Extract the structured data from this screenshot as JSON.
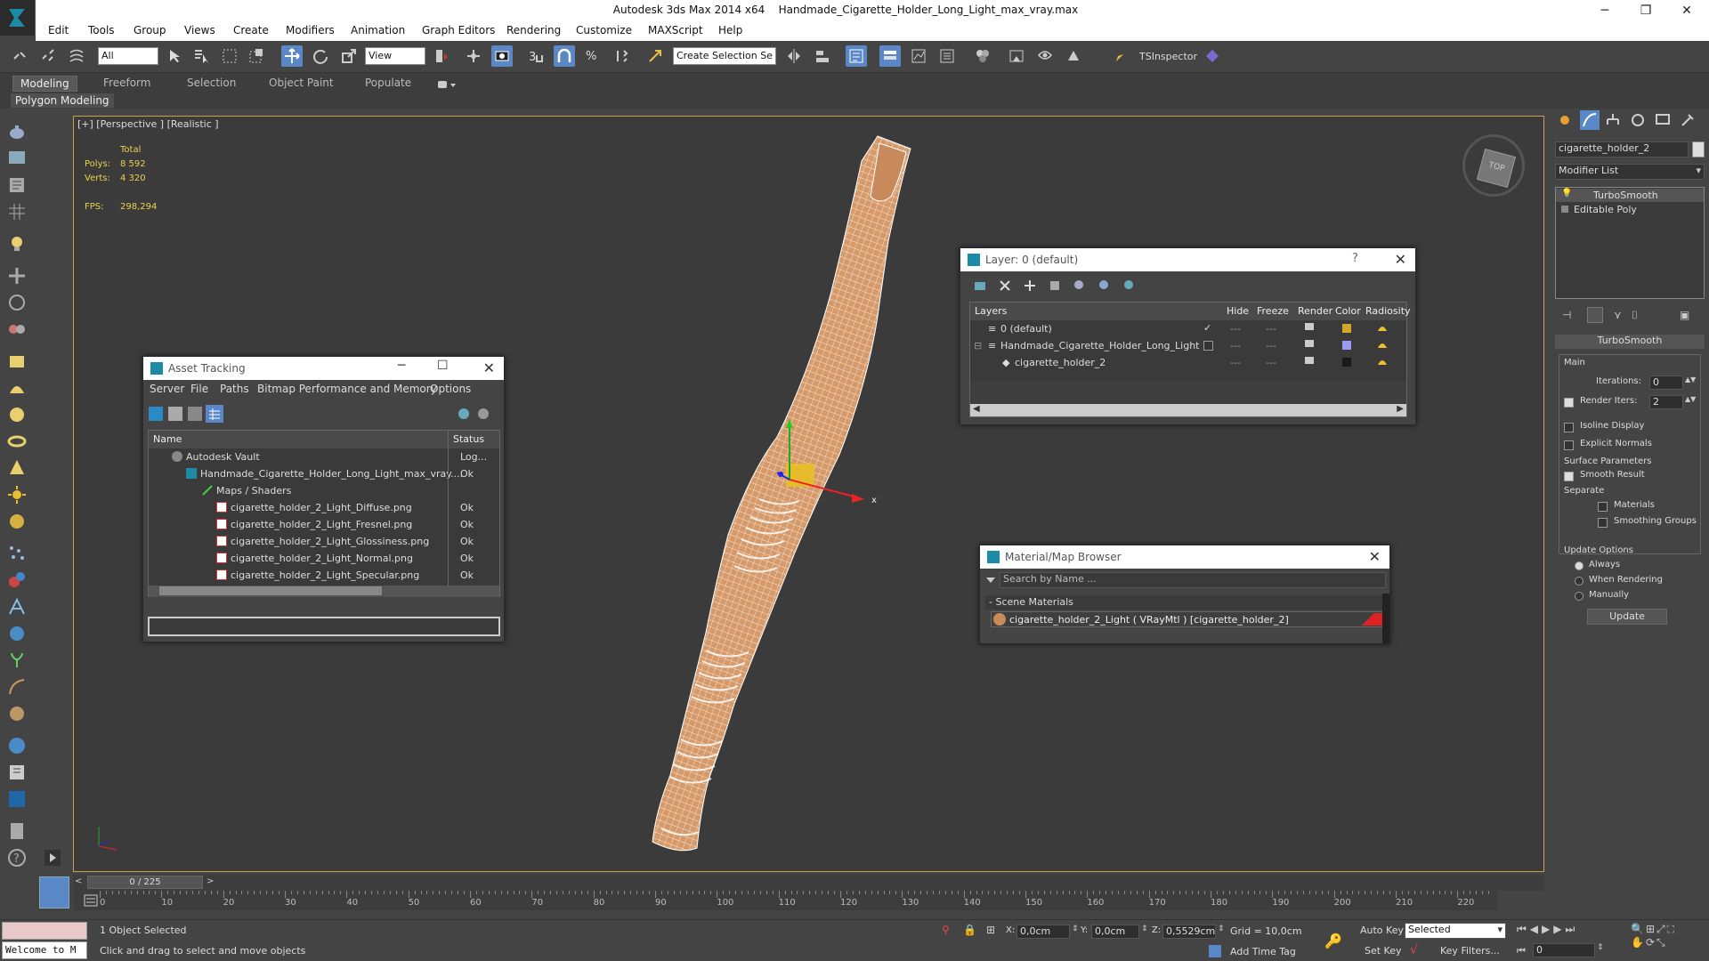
{
  "app": {
    "name": "Autodesk 3ds Max  2014 x64",
    "file": "Handmade_Cigarette_Holder_Long_Light_max_vray.max"
  },
  "menu": [
    "Edit",
    "Tools",
    "Group",
    "Views",
    "Create",
    "Modifiers",
    "Animation",
    "Graph Editors",
    "Rendering",
    "Customize",
    "MAXScript",
    "Help"
  ],
  "toolbar": {
    "filter": "All",
    "view": "View",
    "selection_set": "Create Selection Se",
    "tsinspector": "TSInspector"
  },
  "ribbon": {
    "tabs": [
      "Modeling",
      "Freeform",
      "Selection",
      "Object Paint",
      "Populate"
    ],
    "sub": "Polygon Modeling"
  },
  "viewport": {
    "label": "[+] [Perspective ] [Realistic ]",
    "stats": {
      "total_label": "Total",
      "polys_label": "Polys:",
      "polys": "8 592",
      "verts_label": "Verts:",
      "verts": "4 320",
      "fps_label": "FPS:",
      "fps": "298,294"
    },
    "navcube": "TOP",
    "gizmo_x": "x"
  },
  "asset_tracking": {
    "title": "Asset Tracking",
    "menu": [
      "Server",
      "File",
      "Paths",
      "Bitmap Performance and Memory",
      "Options"
    ],
    "col_name": "Name",
    "col_status": "Status",
    "rows": [
      {
        "name": "Autodesk Vault",
        "status": "Log..."
      },
      {
        "name": "Handmade_Cigarette_Holder_Long_Light_max_vray....",
        "status": "Ok"
      },
      {
        "name": "Maps / Shaders",
        "status": ""
      },
      {
        "name": "cigarette_holder_2_Light_Diffuse.png",
        "status": "Ok"
      },
      {
        "name": "cigarette_holder_2_Light_Fresnel.png",
        "status": "Ok"
      },
      {
        "name": "cigarette_holder_2_Light_Glossiness.png",
        "status": "Ok"
      },
      {
        "name": "cigarette_holder_2_Light_Normal.png",
        "status": "Ok"
      },
      {
        "name": "cigarette_holder_2_Light_Specular.png",
        "status": "Ok"
      }
    ]
  },
  "layer_dialog": {
    "title": "Layer: 0 (default)",
    "help": "?",
    "cols": [
      "Layers",
      "Hide",
      "Freeze",
      "Render",
      "Color",
      "Radiosity"
    ],
    "rows": [
      {
        "name": "0 (default)",
        "color": "#d4a62a"
      },
      {
        "name": "Handmade_Cigarette_Holder_Long_Light",
        "color": "#9a9af0"
      },
      {
        "name": "cigarette_holder_2",
        "color": "#1a1a1a"
      }
    ]
  },
  "material_browser": {
    "title": "Material/Map Browser",
    "search_placeholder": "Search by Name ...",
    "section": "- Scene Materials",
    "item": "cigarette_holder_2_Light  ( VRayMtl ) [cigarette_holder_2]"
  },
  "command_panel": {
    "object_name": "cigarette_holder_2",
    "modifier_list": "Modifier List",
    "stack": [
      "TurboSmooth",
      "Editable Poly"
    ],
    "rollout_title": "TurboSmooth",
    "main_label": "Main",
    "iterations_label": "Iterations:",
    "iterations": "0",
    "render_iters_label": "Render Iters:",
    "render_iters": "2",
    "isoline": "Isoline Display",
    "explicit": "Explicit Normals",
    "surface_label": "Surface Parameters",
    "smooth_result": "Smooth Result",
    "separate_label": "Separate",
    "materials": "Materials",
    "smoothing_groups": "Smoothing Groups",
    "update_options": "Update Options",
    "always": "Always",
    "when_rendering": "When Rendering",
    "manually": "Manually",
    "update_btn": "Update"
  },
  "timeline": {
    "frame": "0 / 225",
    "ticks": [
      "0",
      "10",
      "20",
      "30",
      "40",
      "50",
      "60",
      "70",
      "80",
      "90",
      "100",
      "110",
      "120",
      "130",
      "140",
      "150",
      "160",
      "170",
      "180",
      "190",
      "200",
      "210",
      "220"
    ]
  },
  "status": {
    "maxscript": "Welcome to M",
    "selected": "1 Object Selected",
    "prompt": "Click and drag to select and move objects",
    "x_label": "X:",
    "x": "0,0cm",
    "y_label": "Y:",
    "y": "0,0cm",
    "z_label": "Z:",
    "z": "0,5529cm",
    "grid": "Grid = 10,0cm",
    "add_time_tag": "Add Time Tag",
    "auto_key": "Auto Key",
    "set_key": "Set Key",
    "selected_dd": "Selected",
    "key_filters": "Key Filters...",
    "frame_field": "0"
  }
}
